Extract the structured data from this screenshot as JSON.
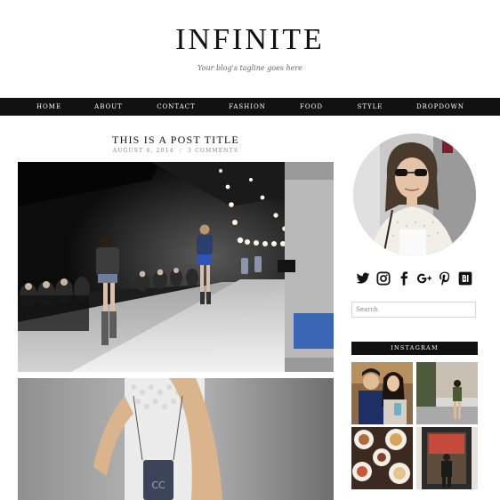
{
  "site": {
    "title": "INFINITE",
    "tagline": "Your blog's tagline goes here"
  },
  "nav": {
    "items": [
      {
        "label": "HOME"
      },
      {
        "label": "ABOUT"
      },
      {
        "label": "CONTACT"
      },
      {
        "label": "FASHION"
      },
      {
        "label": "FOOD"
      },
      {
        "label": "STYLE"
      },
      {
        "label": "DROPDOWN"
      }
    ]
  },
  "post": {
    "title": "THIS IS A POST TITLE",
    "date": "AUGUST 8, 2014",
    "separator": "/",
    "comments": "3 COMMENTS"
  },
  "sidebar": {
    "social_icons": [
      "twitter-icon",
      "instagram-icon",
      "facebook-icon",
      "google-plus-icon",
      "pinterest-icon",
      "bloglovin-icon"
    ],
    "search": {
      "placeholder": "Search",
      "value": ""
    },
    "instagram": {
      "heading": "INSTAGRAM"
    }
  },
  "colors": {
    "navbar": "#111111",
    "nav_text": "#ffffff",
    "accent_blue": "#2d55b8",
    "background": "#ffffff"
  }
}
